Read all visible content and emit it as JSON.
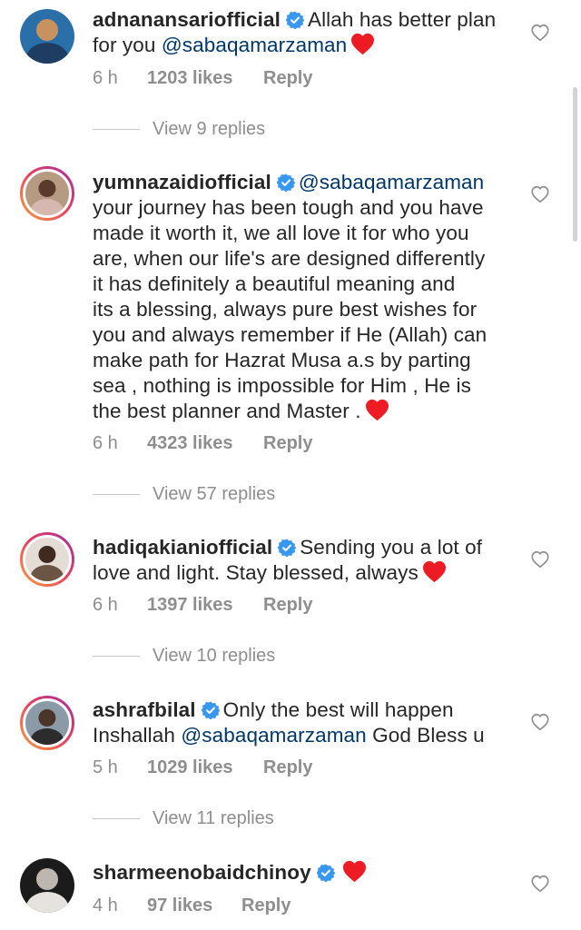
{
  "comments": [
    {
      "username": "adnanansariofficial",
      "text_lines": [
        "Allah has better plan"
      ],
      "line2_prefix": "for you ",
      "mention": "@sabaqamarzaman",
      "time": "6 h",
      "likes": "1203 likes",
      "reply": "Reply",
      "view_replies": "View 9 replies"
    },
    {
      "username": "yumnazaidiofficial",
      "mention": "@sabaqamarzaman",
      "lines": [
        "your journey has been tough and you have",
        "made it worth it, we all love it for who you",
        "are, when our life's are designed differently",
        "it has definitely a beautiful meaning and",
        "its a blessing, always pure best wishes for",
        "you and always remember if He (Allah) can",
        "make path for Hazrat Musa a.s  by parting",
        "sea , nothing is impossible for Him , He is",
        "the best planner and Master ."
      ],
      "time": "6 h",
      "likes": "4323 likes",
      "reply": "Reply",
      "view_replies": "View 57 replies"
    },
    {
      "username": "hadiqakianiofficial",
      "first_line_text": "Sending you a lot of",
      "second_line_text": "love and light. Stay blessed, always",
      "time": "6 h",
      "likes": "1397 likes",
      "reply": "Reply",
      "view_replies": "View 10 replies"
    },
    {
      "username": "ashrafbilal",
      "first_line_text": "Only the best will happen",
      "second_line_prefix": "Inshallah ",
      "mention": "@sabaqamarzaman",
      "second_line_suffix": " God Bless u",
      "time": "5 h",
      "likes": "1029 likes",
      "reply": "Reply",
      "view_replies": "View 11 replies"
    },
    {
      "username": "sharmeenobaidchinoy",
      "time": "4 h",
      "likes": "97 likes",
      "reply": "Reply"
    }
  ],
  "colors": {
    "text": "#262626",
    "muted": "#8e8e8e",
    "mention": "#00376b",
    "verified": "#3897f0",
    "heart": "#ed1c24"
  },
  "icons": {
    "verified": "verified-badge-icon",
    "heart_emoji": "red-heart-emoji-icon",
    "like": "heart-outline-icon"
  }
}
